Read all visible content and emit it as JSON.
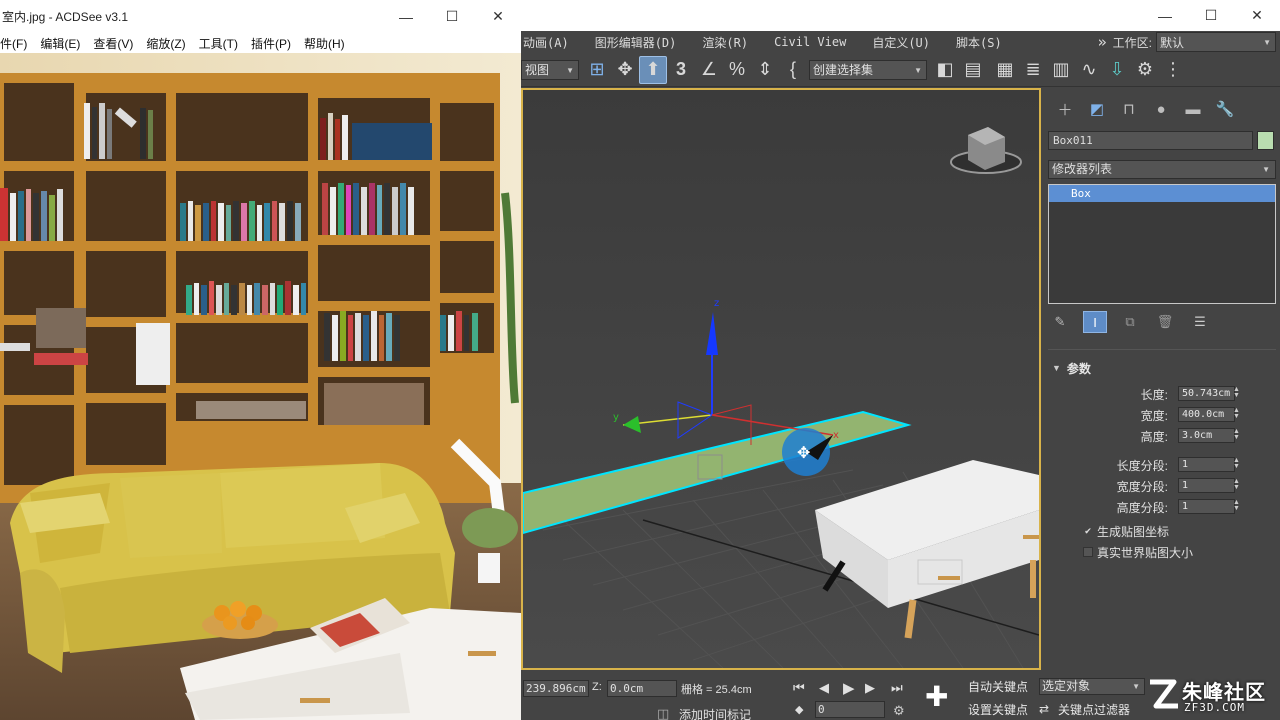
{
  "acdsee": {
    "title": "室内.jpg - ACDSee v3.1",
    "window_controls": {
      "minimize": "—",
      "maximize": "☐",
      "close": "✕"
    },
    "menu": [
      "件(F)",
      "编辑(E)",
      "查看(V)",
      "缩放(Z)",
      "工具(T)",
      "插件(P)",
      "帮助(H)"
    ]
  },
  "max": {
    "window_controls": {
      "minimize": "—",
      "maximize": "☐",
      "close": "✕"
    },
    "menu": [
      "动画(A)",
      "图形编辑器(D)",
      "渲染(R)",
      "Civil View",
      "自定义(U)",
      "脚本(S)"
    ],
    "overflow_chevron": "»",
    "workspace_label": "工作区:",
    "workspace_value": "默认",
    "toolbar": {
      "view_dropdown": "视图",
      "selection_set_dropdown": "创建选择集"
    },
    "command_panel": {
      "object_name": "Box011",
      "object_color": "#b9ddb0",
      "modifier_list_label": "修改器列表",
      "stack_items": [
        "Box"
      ],
      "rollout_title": "参数",
      "params": [
        {
          "label": "长度:",
          "value": "50.743cm"
        },
        {
          "label": "宽度:",
          "value": "400.0cm"
        },
        {
          "label": "高度:",
          "value": "3.0cm"
        },
        {
          "label": "长度分段:",
          "value": "1"
        },
        {
          "label": "宽度分段:",
          "value": "1"
        },
        {
          "label": "高度分段:",
          "value": "1"
        }
      ],
      "checkboxes": [
        {
          "label": "生成贴图坐标",
          "checked": true
        },
        {
          "label": "真实世界贴图大小",
          "checked": false
        }
      ]
    },
    "viewport": {
      "gizmo_axis_labels": {
        "x": "x",
        "y": "y",
        "z": "z"
      },
      "selected_color": "#00e5ff"
    },
    "statusbar": {
      "y_coord": "239.896cm",
      "z_label": "Z:",
      "z_coord": "0.0cm",
      "grid_label": "栅格 = 25.4cm",
      "add_time_tag": "添加时间标记",
      "frame_value": "0",
      "auto_key": "自动关键点",
      "set_key": "设置关键点",
      "selected_object_dropdown": "选定对象",
      "key_filters": "关键点过滤器"
    }
  },
  "watermark": {
    "text": "朱峰社区",
    "url": "ZF3D.COM"
  }
}
